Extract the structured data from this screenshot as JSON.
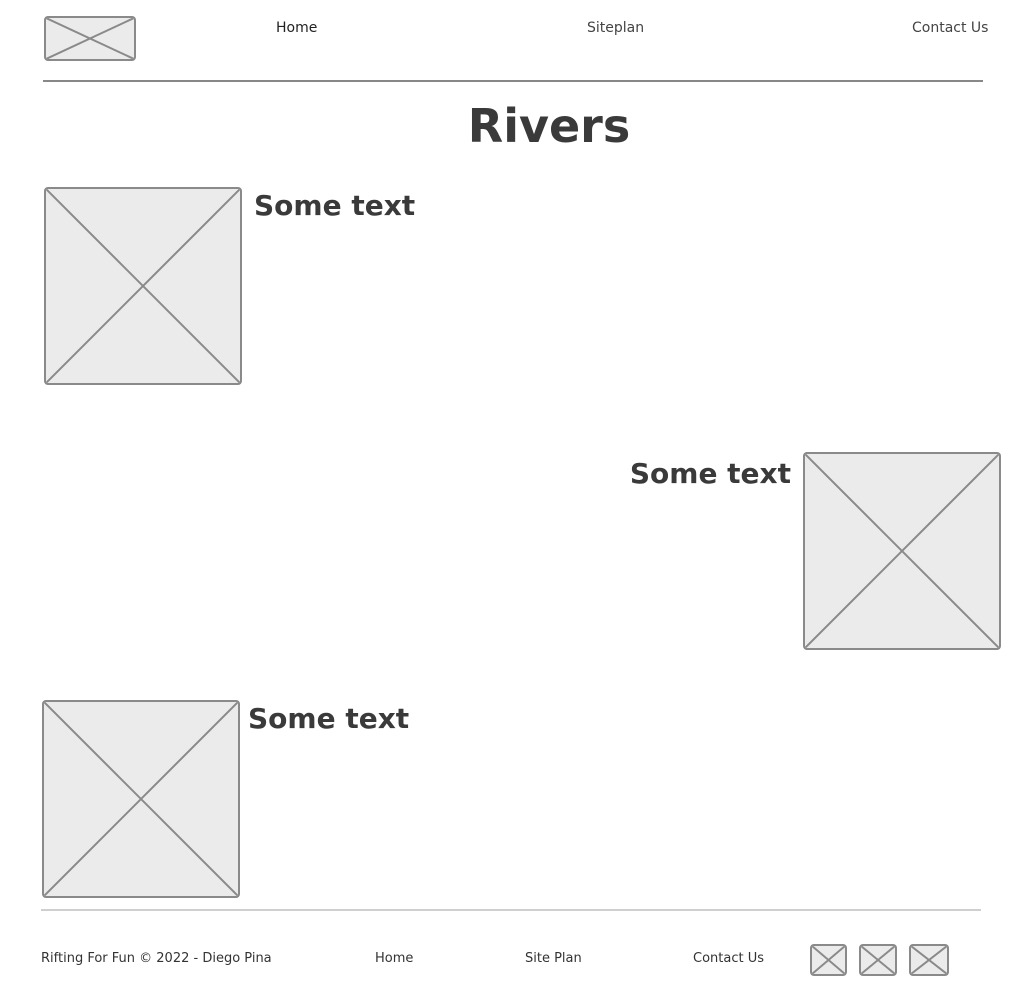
{
  "header": {
    "logo_icon": "image-placeholder-icon",
    "nav": {
      "home": "Home",
      "siteplan": "Siteplan",
      "contact": "Contact Us"
    }
  },
  "main": {
    "title": "Rivers",
    "sections": [
      {
        "heading": "Some text",
        "image_icon": "image-placeholder-icon"
      },
      {
        "heading": "Some text",
        "image_icon": "image-placeholder-icon"
      },
      {
        "heading": "Some text",
        "image_icon": "image-placeholder-icon"
      }
    ]
  },
  "footer": {
    "copyright": "Rifting For Fun © 2022 - Diego Pina",
    "links": {
      "home": "Home",
      "siteplan": "Site Plan",
      "contact": "Contact Us"
    },
    "social_icons": [
      "image-placeholder-icon",
      "image-placeholder-icon",
      "image-placeholder-icon"
    ]
  },
  "colors": {
    "placeholder_fill": "#ebebeb",
    "placeholder_stroke": "#8a8a8a",
    "text": "#3a3a3a"
  }
}
